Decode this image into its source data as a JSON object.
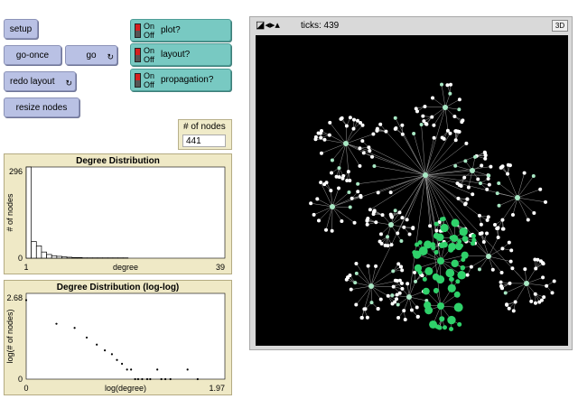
{
  "buttons": {
    "setup": "setup",
    "go_once": "go-once",
    "go": "go",
    "redo_layout": "redo layout",
    "resize_nodes": "resize nodes",
    "forever_glyph": "↻"
  },
  "switches": [
    {
      "label": "plot?",
      "on": "On",
      "off": "Off"
    },
    {
      "label": "layout?",
      "on": "On",
      "off": "Off"
    },
    {
      "label": "propagation?",
      "on": "On",
      "off": "Off"
    }
  ],
  "monitor": {
    "label": "# of nodes",
    "value": "441"
  },
  "view": {
    "ticks": "ticks: 439",
    "btn3d": "3D",
    "background": "#000000",
    "node_white": "#ffffff",
    "node_green": "#2fd16a"
  },
  "chart_data": [
    {
      "type": "bar",
      "title": "Degree Distribution",
      "xlabel": "degree",
      "ylabel": "# of nodes",
      "xlim": [
        1,
        39
      ],
      "ylim": [
        0,
        296
      ],
      "x_tick_labels": [
        "1",
        "39"
      ],
      "y_tick_labels": [
        "0",
        "296"
      ],
      "x": [
        1,
        2,
        3,
        4,
        5,
        6,
        7,
        8,
        9,
        10,
        11,
        12,
        13,
        14,
        15,
        16,
        17,
        18,
        19,
        20
      ],
      "values": [
        296,
        54,
        40,
        20,
        12,
        8,
        6,
        4,
        3,
        2,
        2,
        1,
        1,
        1,
        1,
        1,
        1,
        1,
        1,
        1
      ]
    },
    {
      "type": "scatter",
      "title": "Degree Distribution (log-log)",
      "xlabel": "log(degree)",
      "ylabel": "log(# of nodes)",
      "xlim": [
        0,
        1.97
      ],
      "ylim": [
        0,
        2.68
      ],
      "x_tick_labels": [
        "0",
        "1.97"
      ],
      "y_tick_labels": [
        "0",
        "2.68"
      ],
      "points": [
        [
          0.0,
          2.47
        ],
        [
          0.3,
          1.73
        ],
        [
          0.48,
          1.6
        ],
        [
          0.6,
          1.3
        ],
        [
          0.7,
          1.08
        ],
        [
          0.78,
          0.9
        ],
        [
          0.85,
          0.78
        ],
        [
          0.9,
          0.6
        ],
        [
          0.95,
          0.48
        ],
        [
          1.0,
          0.3
        ],
        [
          1.04,
          0.3
        ],
        [
          1.08,
          0.0
        ],
        [
          1.11,
          0.0
        ],
        [
          1.15,
          0.0
        ],
        [
          1.2,
          0.0
        ],
        [
          1.23,
          0.0
        ],
        [
          1.3,
          0.3
        ],
        [
          1.34,
          0.0
        ],
        [
          1.38,
          0.0
        ],
        [
          1.43,
          0.0
        ],
        [
          1.6,
          0.3
        ],
        [
          1.7,
          0.0
        ]
      ]
    }
  ]
}
